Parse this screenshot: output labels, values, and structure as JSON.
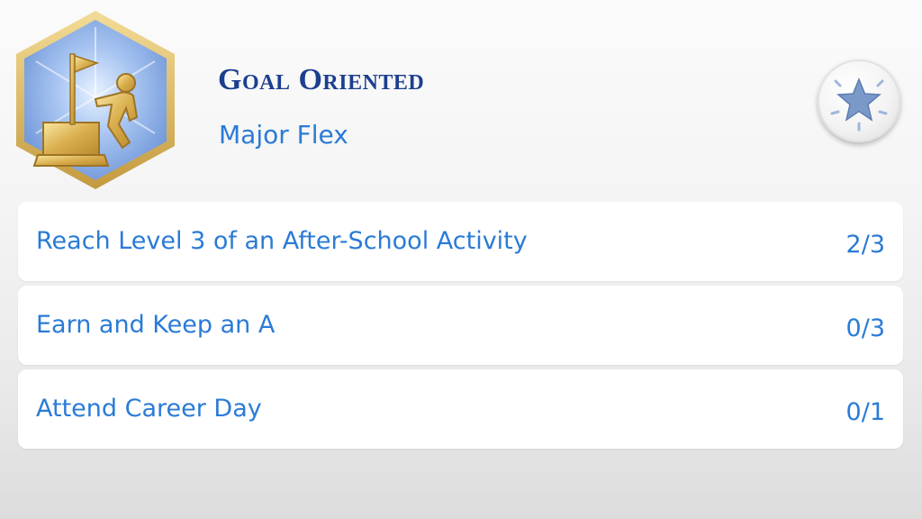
{
  "aspiration": {
    "title": "Goal Oriented",
    "subtitle": "Major Flex",
    "badge_icon": "climber-on-summit-flag-icon",
    "reward_icon": "star-icon"
  },
  "goals": [
    {
      "label": "Reach Level 3 of an After-School Activity",
      "progress": "2/3"
    },
    {
      "label": "Earn and Keep an A",
      "progress": "0/3"
    },
    {
      "label": "Attend Career Day",
      "progress": "0/1"
    }
  ],
  "colors": {
    "title": "#1c3f8e",
    "text_accent": "#2a7bd6",
    "badge_border": "#d4b25a",
    "badge_fill": "#8fb3ea"
  }
}
